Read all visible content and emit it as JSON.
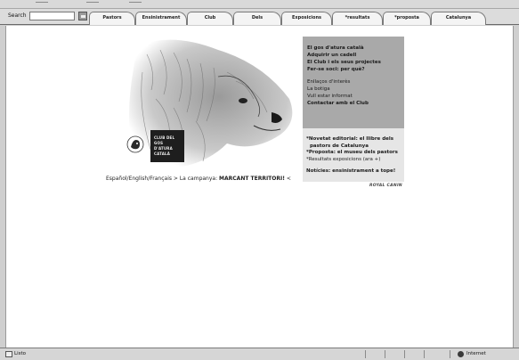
{
  "toolbar": {
    "search_label": "Search",
    "search_value": ""
  },
  "tabs": [
    {
      "label": "Pastors"
    },
    {
      "label": "Ensinistrament"
    },
    {
      "label": "Club"
    },
    {
      "label": "Dels"
    },
    {
      "label": "Exposicions"
    },
    {
      "label": "*resultats"
    },
    {
      "label": "*proposta"
    },
    {
      "label": "Catalunya"
    }
  ],
  "logo": {
    "line1": "CLUB DEL",
    "line2": "GOS D'ATURA",
    "line3": "CATALÀ"
  },
  "menu": {
    "bold_items": [
      "El gos d'atura català",
      "Adquirir un cadell",
      "El Club i els seus projectes",
      "Fer-se soci: per què?"
    ],
    "items": [
      "Enllaços d'interès",
      "La botiga",
      "Vull estar informat"
    ],
    "contact": "Contactar amb el Club"
  },
  "news": {
    "item1": "*Novetat editorial: el llibre dels",
    "item1b": "pastors de Catalunya",
    "item2": "*Proposta: el museu dels pastors",
    "item3": "*Resultats exposicions (ara +)",
    "item4": "Notícies: ensinistrament a tope!"
  },
  "lang_line": {
    "languages": "Español/English/Français > La campanya:",
    "campaign": "MARCANT TERRITORI!",
    "suffix": " <"
  },
  "sponsor": "ROYAL CANIN",
  "statusbar": {
    "status": "Listo",
    "zone": "Internet"
  }
}
